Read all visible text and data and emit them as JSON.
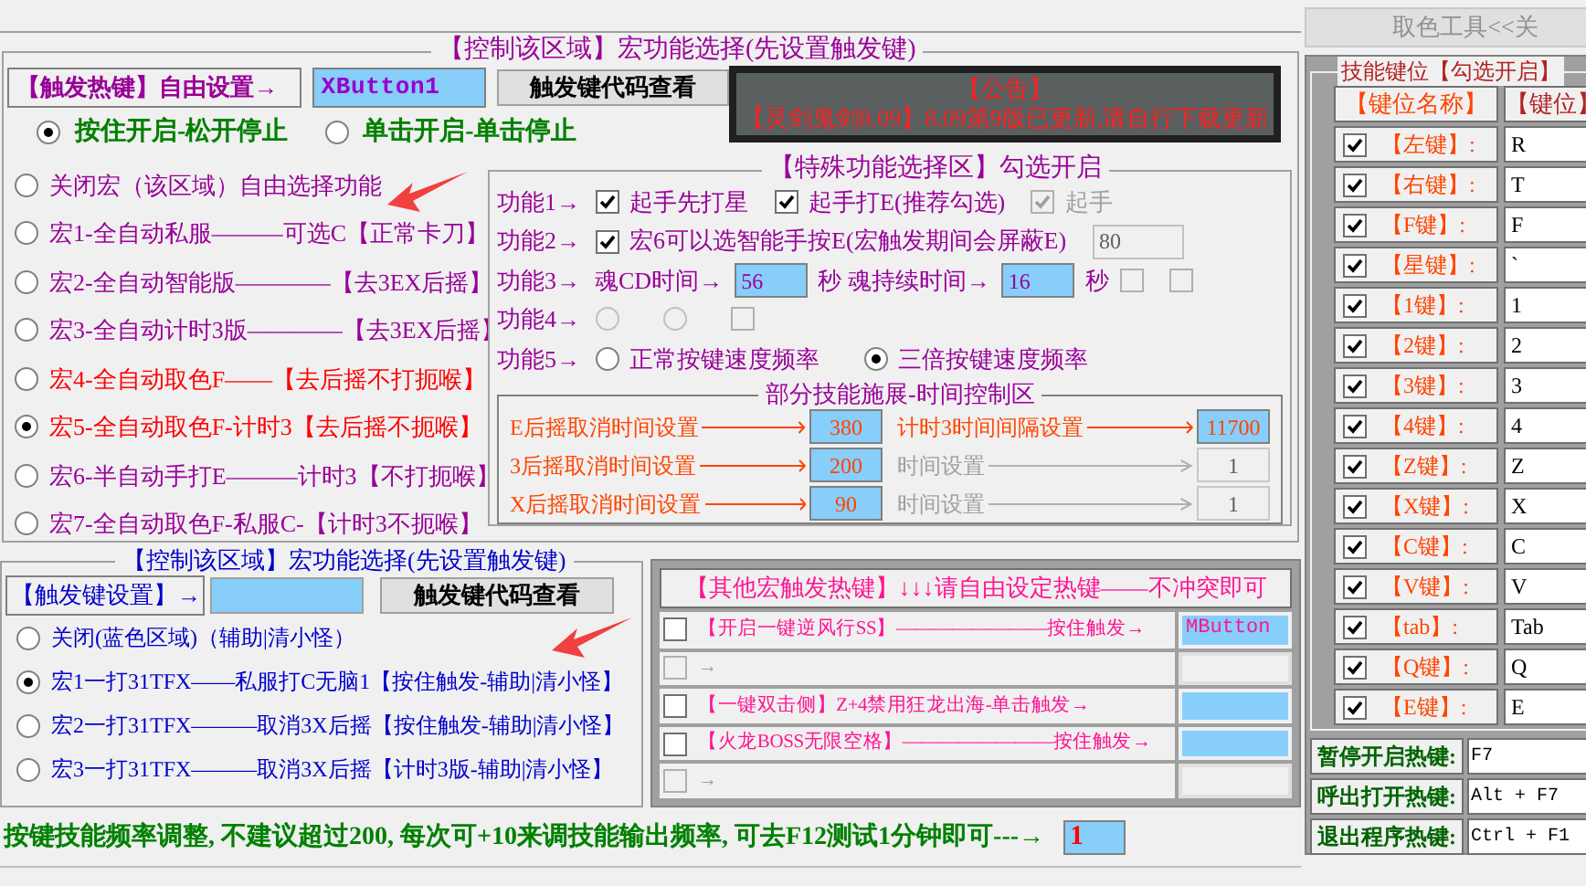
{
  "upper": {
    "title": "【控制该区域】宏功能选择(先设置触发键)",
    "trigger": {
      "label": "【触发热键】自由设置→",
      "value": "XButton1",
      "button": "触发键代码查看"
    },
    "modes": [
      {
        "label": "按住开启-松开停止",
        "selected": true
      },
      {
        "label": "单击开启-单击停止",
        "selected": false
      }
    ],
    "macros": [
      {
        "label": "关闭宏（该区域）自由选择功能",
        "selected": false,
        "color": "#990099"
      },
      {
        "label": "宏1-全自动私服———可选C【正常卡刀】",
        "selected": false,
        "color": "#990099"
      },
      {
        "label": "宏2-全自动智能版————【去3EX后摇】",
        "selected": false,
        "color": "#990099"
      },
      {
        "label": "宏3-全自动计时3版————【去3EX后摇】",
        "selected": false,
        "color": "#990099"
      },
      {
        "label": "宏4-全自动取色F——【去后摇不打扼喉】",
        "selected": false,
        "color": "#ff0000"
      },
      {
        "label": "宏5-全自动取色F-计时3【去后摇不扼喉】",
        "selected": true,
        "color": "#ff0000"
      },
      {
        "label": "宏6-半自动手打E———计时3【不打扼喉】",
        "selected": false,
        "color": "#990099"
      },
      {
        "label": "宏7-全自动取色F-私服C-【计时3不扼喉】",
        "selected": false,
        "color": "#990099"
      }
    ]
  },
  "notice": {
    "title": "【公告】",
    "text": "【灵剑鬼剑8.09】8.09第9版已更新,请自行下载更新"
  },
  "special": {
    "title": "【特殊功能选择区】勾选开启",
    "rows": [
      {
        "label": "功能1→",
        "items": [
          {
            "kind": "checkbox",
            "label": "起手先打星",
            "checked": true,
            "disabled": false
          },
          {
            "kind": "checkbox",
            "label": "起手打E(推荐勾选)",
            "checked": true,
            "disabled": false
          },
          {
            "kind": "checkbox",
            "label": "起手",
            "checked": true,
            "disabled": true
          }
        ]
      },
      {
        "label": "功能2→",
        "items": [
          {
            "kind": "checkbox",
            "label": "宏6可以选智能手按E(宏触发期间会屏蔽E)",
            "checked": true,
            "disabled": false
          },
          {
            "kind": "input",
            "value": "80",
            "disabled": true
          }
        ]
      },
      {
        "label": "功能3→",
        "items": [
          {
            "kind": "text",
            "label": "魂CD时间→"
          },
          {
            "kind": "input",
            "value": "56",
            "disabled": false
          },
          {
            "kind": "text",
            "label": "秒 魂持续时间→"
          },
          {
            "kind": "input",
            "value": "16",
            "disabled": false
          },
          {
            "kind": "text",
            "label": "秒"
          },
          {
            "kind": "checkbox",
            "checked": false,
            "disabled": true
          },
          {
            "kind": "checkbox",
            "checked": false,
            "disabled": true
          }
        ]
      },
      {
        "label": "功能4→",
        "items": [
          {
            "kind": "radio",
            "selected": false,
            "disabled": true
          },
          {
            "kind": "radio",
            "selected": false,
            "disabled": true
          },
          {
            "kind": "checkbox",
            "checked": false,
            "disabled": true
          }
        ]
      },
      {
        "label": "功能5→",
        "items": [
          {
            "kind": "radio",
            "label": "正常按键速度频率",
            "selected": false,
            "disabled": false
          },
          {
            "kind": "radio",
            "label": "三倍按键速度频率",
            "selected": true,
            "disabled": false
          }
        ]
      }
    ],
    "timing": {
      "title": "部分技能施展-时间控制区",
      "cells": [
        {
          "label": "E后摇取消时间设置",
          "value": "380",
          "disabled": false
        },
        {
          "label": "计时3时间间隔设置",
          "value": "11700",
          "disabled": false
        },
        {
          "label": "3后摇取消时间设置",
          "value": "200",
          "disabled": false
        },
        {
          "label": "时间设置",
          "value": "1",
          "disabled": true
        },
        {
          "label": "X后摇取消时间设置",
          "value": "90",
          "disabled": false
        },
        {
          "label": "时间设置",
          "value": "1",
          "disabled": true
        }
      ]
    }
  },
  "lower": {
    "title": "【控制该区域】宏功能选择(先设置触发键)",
    "trigger": {
      "label": "【触发键设置】→",
      "button": "触发键代码查看"
    },
    "macros": [
      {
        "label": "关闭(蓝色区域)（辅助|清小怪）",
        "selected": false
      },
      {
        "label": "宏1一打31TFX——私服打C无脑1【按住触发-辅助|清小怪】",
        "selected": true
      },
      {
        "label": "宏2一打31TFX———取消3X后摇【按住触发-辅助|清小怪】",
        "selected": false
      },
      {
        "label": "宏3一打31TFX———取消3X后摇【计时3版-辅助|清小怪】",
        "selected": false
      }
    ]
  },
  "other": {
    "title": "【其他宏触发热键】↓↓↓请自由设定热键——不冲突即可",
    "rows": [
      {
        "label": "【开启一键逆风行SS】————————按住触发→",
        "value": "MButton",
        "checked": false,
        "disabled": false
      },
      {
        "label": "→",
        "checked": false,
        "disabled": true
      },
      {
        "label": "【一键双击侧】Z+4禁用狂龙出海-单击触发→",
        "checked": false,
        "disabled": false
      },
      {
        "label": "【火龙BOSS无限空格】————————按住触发→",
        "checked": false,
        "disabled": false
      },
      {
        "label": "→",
        "checked": false,
        "disabled": true
      }
    ]
  },
  "footer": {
    "text": "按键技能频率调整, 不建议超过200, 每次可+10来调技能输出频率, 可去F12测试1分钟即可---→",
    "value": "1"
  },
  "color_tool": {
    "button": "取色工具<<关"
  },
  "keys": {
    "title": "技能键位【勾选开启】",
    "columns": [
      "【键位名称】",
      "【键位】"
    ],
    "rows": [
      {
        "name": "【左键】:",
        "value": "R",
        "checked": true
      },
      {
        "name": "【右键】:",
        "value": "T",
        "checked": true
      },
      {
        "name": "【F键】:",
        "value": "F",
        "checked": true
      },
      {
        "name": "【星键】:",
        "value": "`",
        "checked": true
      },
      {
        "name": "【1键】:",
        "value": "1",
        "checked": true
      },
      {
        "name": "【2键】:",
        "value": "2",
        "checked": true
      },
      {
        "name": "【3键】:",
        "value": "3",
        "checked": true
      },
      {
        "name": "【4键】:",
        "value": "4",
        "checked": true
      },
      {
        "name": "【Z键】:",
        "value": "Z",
        "checked": true
      },
      {
        "name": "【X键】:",
        "value": "X",
        "checked": true
      },
      {
        "name": "【C键】:",
        "value": "C",
        "checked": true
      },
      {
        "name": "【V键】:",
        "value": "V",
        "checked": true
      },
      {
        "name": "【tab】:",
        "value": "Tab",
        "checked": true
      },
      {
        "name": "【Q键】:",
        "value": "Q",
        "checked": true
      },
      {
        "name": "【E键】:",
        "value": "E",
        "checked": true
      }
    ],
    "hotkeys": [
      {
        "label": "暂停开启热键:",
        "value": "F7"
      },
      {
        "label": "呼出打开热键:",
        "value": "Alt + F7"
      },
      {
        "label": "退出程序热键:",
        "value": "Ctrl + F1"
      }
    ]
  }
}
